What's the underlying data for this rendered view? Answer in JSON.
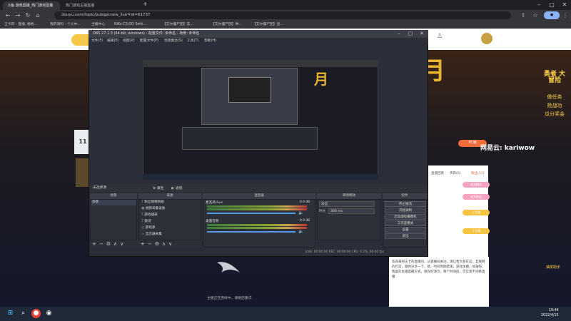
{
  "browser": {
    "tabs": [
      {
        "label": "斗鱼·游戏直播_热门游戏直播",
        "active": true
      },
      {
        "label": "热门游戏主播直播",
        "active": false
      }
    ],
    "url": "douyu.com/topic/pubgpcnew_live?rid=61737",
    "bookmarks": [
      "王卡的 - 直播, 格格...",
      "我的资料 - 个人中...",
      "主播中心",
      "NiKo CS:GO Setti...",
      "【艾尔僵尸团】实...",
      "【艾尔僵尸团】钟...",
      "【艾尔僵尸团】显..."
    ]
  },
  "site": {
    "banner_text": "月",
    "promo_text": "勇者 大冒险",
    "promo_buttons": [
      "做任务",
      "抢战功",
      "瓜分奖金"
    ],
    "watermark": "网易云: kariwow",
    "left_box_number": "11",
    "chat_tabs": [
      "直播回看",
      "贵宾(0)",
      "粉丝(11)"
    ],
    "chat_badges": [
      "成为粉丝",
      "成为粉丝",
      "十主播",
      "十主播"
    ],
    "pc_button": "PC端",
    "right_panel_text": "欢迎来到王卡的直播间，从直播间关注，请让我大家在这，互联网的打造，跟你分享一下，嗯，时间周期结束，游戏主播，加油呀，我喜欢主播直播方式，很好的演示，每个时间段，可实现不间断直播",
    "lottery_label": "抽奖助手"
  },
  "obs": {
    "title": "OBS 27.1.3 (64-bit, windows) - 配置文件: 未命名 - 场景: 未命名",
    "menu": [
      "文件(F)",
      "编辑(E)",
      "视图(V)",
      "配置文件(P)",
      "场景集合(S)",
      "工具(T)",
      "帮助(H)"
    ],
    "scene_selection": "未选择源",
    "scene_tabs": [
      "属性",
      "滤镜"
    ],
    "dock_headers": [
      "场景",
      "来源",
      "混音器",
      "转场特效",
      "控件"
    ],
    "scenes": [
      "场景"
    ],
    "sources": [
      "粉丝捐赠贡献",
      "视频采集设备",
      "游戏捕获",
      "歌词",
      "游戏源",
      "显示器采集"
    ],
    "mixer": {
      "tracks": [
        {
          "name": "麦克风/Aux",
          "db": "0.0 dB"
        },
        {
          "name": "桌面音频",
          "db": "0.0 dB"
        }
      ]
    },
    "transition": {
      "type": "淡出",
      "duration_label": "时长",
      "duration": "300 ms"
    },
    "controls": [
      "停止推流",
      "开始录制",
      "启动虚拟摄像机",
      "工作室模式",
      "设置",
      "退出"
    ],
    "status": "LIVE: 00:00:00   REC: 00:00:00   CPU: 0.1%, 60.00 fps",
    "caption": "主播正在连线中，请稍后重试"
  },
  "taskbar": {
    "time": "19:44",
    "date": "2022/4/15"
  }
}
